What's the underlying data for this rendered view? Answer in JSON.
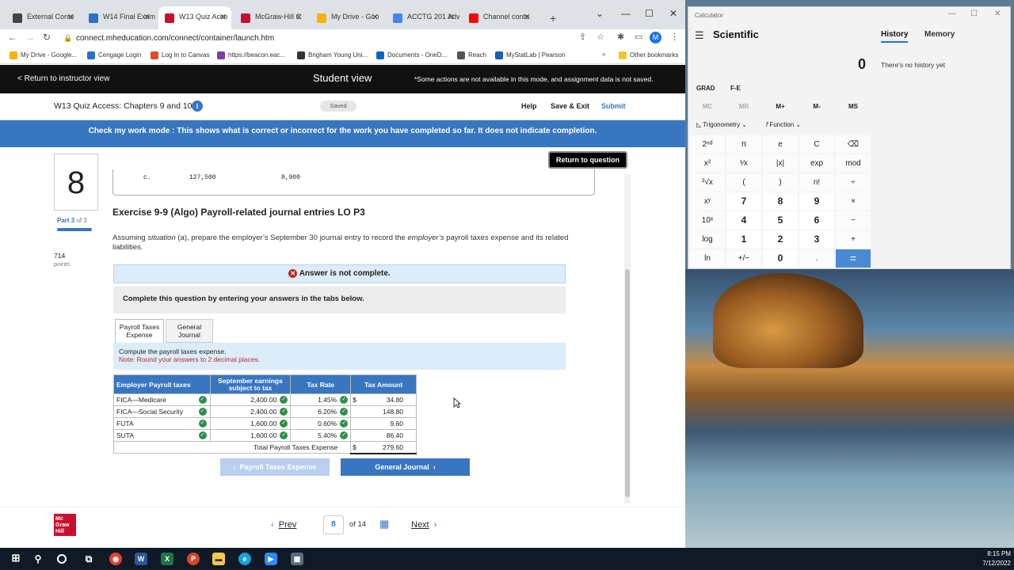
{
  "browser": {
    "tabs": [
      {
        "label": "External Conte",
        "icon": "external-content-icon",
        "color": "#444444"
      },
      {
        "label": "W14 Final Exam",
        "icon": "chart-icon",
        "color": "#2a6fc9"
      },
      {
        "label": "W13 Quiz Acce",
        "icon": "mcgraw-m-icon",
        "color": "#c8102e"
      },
      {
        "label": "McGraw-Hill C",
        "icon": "mcgraw-m-icon",
        "color": "#c8102e"
      },
      {
        "label": "My Drive - Goo",
        "icon": "google-drive-icon",
        "color": "#f4b400"
      },
      {
        "label": "ACCTG 201 Adv",
        "icon": "docs-icon",
        "color": "#4285f4"
      },
      {
        "label": "Channel conte",
        "icon": "youtube-icon",
        "color": "#ff0000"
      }
    ],
    "url": "connect.mheducation.com/connect/container/launch.htm",
    "bookmarks": [
      "My Drive - Google...",
      "Cengage Login",
      "Log In to Canvas",
      "https://beacon.eac...",
      "Brigham Young Uni...",
      "Documents - OneD...",
      "Reach",
      "MyStatLab | Pearson"
    ],
    "other_bookmarks": "Other bookmarks"
  },
  "header": {
    "return_link": "< Return to instructor view",
    "view_title": "Student view",
    "notice": "*Some actions are not available in this mode, and assignment data is not saved.",
    "quiz_title": "W13 Quiz Access: Chapters 9 and 10",
    "saved": "Saved",
    "help": "Help",
    "save_exit": "Save & Exit",
    "submit": "Submit"
  },
  "check_mode": "Check my work mode : This shows what is correct or incorrect for the work you have completed so far. It does not indicate completion.",
  "question": {
    "number": "8",
    "part_label": "Part 3",
    "part_of": "of 3",
    "points_value": "714",
    "points_label": "points",
    "return_btn": "Return to question",
    "prev_snippet": {
      "letter": "c.",
      "a": "127,500",
      "b": "8,900"
    },
    "title": "Exercise 9-9 (Algo) Payroll-related journal entries LO P3",
    "prompt_1": "Assuming ",
    "prompt_situation": "situation",
    "prompt_2": " (a), prepare the employer’s September 30 journal entry to record the ",
    "prompt_employer": "employer’s",
    "prompt_3": " payroll taxes expense and its related liabilities.",
    "answer_status": "Answer is not complete.",
    "instruction": "Complete this question by entering your answers in the tabs below.",
    "tabs": [
      "Payroll Taxes Expense",
      "General Journal"
    ],
    "compute_text": "Compute the payroll taxes expense.",
    "note_text": "Note: Round your answers to 2 decimal places.",
    "table": {
      "headers": [
        "Employer Payroll taxes",
        "September earnings subject to tax",
        "Tax Rate",
        "Tax Amount"
      ],
      "rows": [
        {
          "tax": "FICA—Medicare",
          "earnings": "2,400.00",
          "rate": "1.45%",
          "dollar": "$",
          "amount": "34.80"
        },
        {
          "tax": "FICA—Social Security",
          "earnings": "2,400.00",
          "rate": "6.20%",
          "dollar": "",
          "amount": "148.80"
        },
        {
          "tax": "FUTA",
          "earnings": "1,600.00",
          "rate": "0.60%",
          "dollar": "",
          "amount": "9.60"
        },
        {
          "tax": "SUTA",
          "earnings": "1,600.00",
          "rate": "5.40%",
          "dollar": "",
          "amount": "86.40"
        }
      ],
      "total_label": "Total Payroll Taxes Expense",
      "total_dollar": "$",
      "total_value": "279.60"
    },
    "prev_tab_btn": "Payroll Taxes Expense",
    "next_tab_btn": "General Journal"
  },
  "footer": {
    "logo_lines": [
      "Mc",
      "Graw",
      "Hill"
    ],
    "prev": "Prev",
    "page": "8",
    "of_total": "of 14",
    "next": "Next"
  },
  "calculator": {
    "window_title": "Calculator",
    "mode": "Scientific",
    "history_tab": "History",
    "memory_tab": "Memory",
    "display": "0",
    "history_empty": "There's no history yet",
    "angle": "GRAD",
    "fe": "F-E",
    "memory_keys": [
      "MC",
      "MR",
      "M+",
      "M-",
      "MS"
    ],
    "trig": "Trigonometry",
    "func": "Function",
    "keys": [
      [
        "2ⁿᵈ",
        "π",
        "e",
        "C",
        "⌫"
      ],
      [
        "x²",
        "¹⁄x",
        "|x|",
        "exp",
        "mod"
      ],
      [
        "²√x",
        "(",
        ")",
        "n!",
        "÷"
      ],
      [
        "xʸ",
        "7",
        "8",
        "9",
        "×"
      ],
      [
        "10ˣ",
        "4",
        "5",
        "6",
        "−"
      ],
      [
        "log",
        "1",
        "2",
        "3",
        "+"
      ],
      [
        "ln",
        "+/−",
        "0",
        ".",
        "="
      ]
    ]
  },
  "taskbar": {
    "time": "8:15 PM",
    "date": "7/12/2022"
  }
}
